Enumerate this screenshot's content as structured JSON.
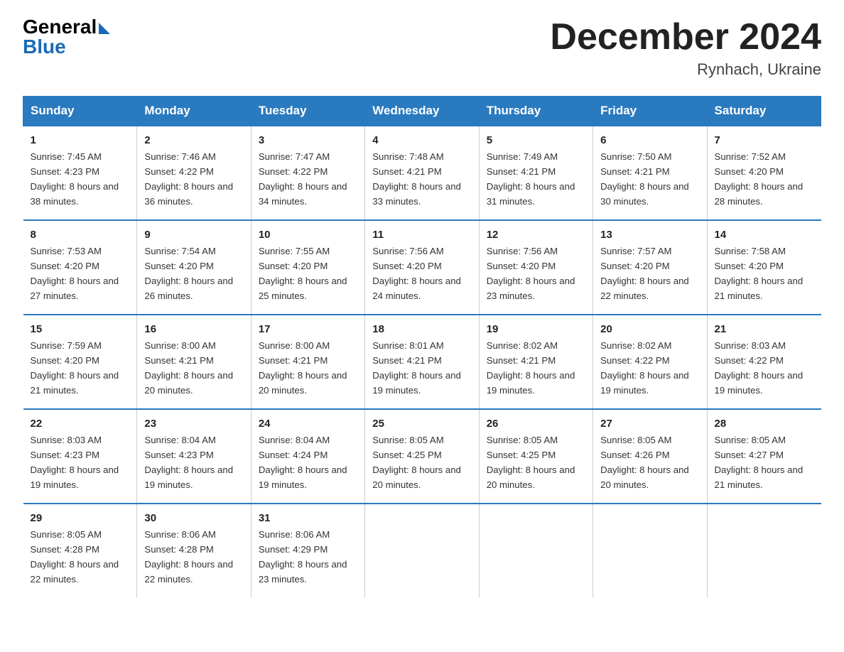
{
  "logo": {
    "general": "General",
    "blue": "Blue"
  },
  "title": "December 2024",
  "location": "Rynhach, Ukraine",
  "days_of_week": [
    "Sunday",
    "Monday",
    "Tuesday",
    "Wednesday",
    "Thursday",
    "Friday",
    "Saturday"
  ],
  "weeks": [
    [
      {
        "day": "1",
        "sunrise": "7:45 AM",
        "sunset": "4:23 PM",
        "daylight": "8 hours and 38 minutes."
      },
      {
        "day": "2",
        "sunrise": "7:46 AM",
        "sunset": "4:22 PM",
        "daylight": "8 hours and 36 minutes."
      },
      {
        "day": "3",
        "sunrise": "7:47 AM",
        "sunset": "4:22 PM",
        "daylight": "8 hours and 34 minutes."
      },
      {
        "day": "4",
        "sunrise": "7:48 AM",
        "sunset": "4:21 PM",
        "daylight": "8 hours and 33 minutes."
      },
      {
        "day": "5",
        "sunrise": "7:49 AM",
        "sunset": "4:21 PM",
        "daylight": "8 hours and 31 minutes."
      },
      {
        "day": "6",
        "sunrise": "7:50 AM",
        "sunset": "4:21 PM",
        "daylight": "8 hours and 30 minutes."
      },
      {
        "day": "7",
        "sunrise": "7:52 AM",
        "sunset": "4:20 PM",
        "daylight": "8 hours and 28 minutes."
      }
    ],
    [
      {
        "day": "8",
        "sunrise": "7:53 AM",
        "sunset": "4:20 PM",
        "daylight": "8 hours and 27 minutes."
      },
      {
        "day": "9",
        "sunrise": "7:54 AM",
        "sunset": "4:20 PM",
        "daylight": "8 hours and 26 minutes."
      },
      {
        "day": "10",
        "sunrise": "7:55 AM",
        "sunset": "4:20 PM",
        "daylight": "8 hours and 25 minutes."
      },
      {
        "day": "11",
        "sunrise": "7:56 AM",
        "sunset": "4:20 PM",
        "daylight": "8 hours and 24 minutes."
      },
      {
        "day": "12",
        "sunrise": "7:56 AM",
        "sunset": "4:20 PM",
        "daylight": "8 hours and 23 minutes."
      },
      {
        "day": "13",
        "sunrise": "7:57 AM",
        "sunset": "4:20 PM",
        "daylight": "8 hours and 22 minutes."
      },
      {
        "day": "14",
        "sunrise": "7:58 AM",
        "sunset": "4:20 PM",
        "daylight": "8 hours and 21 minutes."
      }
    ],
    [
      {
        "day": "15",
        "sunrise": "7:59 AM",
        "sunset": "4:20 PM",
        "daylight": "8 hours and 21 minutes."
      },
      {
        "day": "16",
        "sunrise": "8:00 AM",
        "sunset": "4:21 PM",
        "daylight": "8 hours and 20 minutes."
      },
      {
        "day": "17",
        "sunrise": "8:00 AM",
        "sunset": "4:21 PM",
        "daylight": "8 hours and 20 minutes."
      },
      {
        "day": "18",
        "sunrise": "8:01 AM",
        "sunset": "4:21 PM",
        "daylight": "8 hours and 19 minutes."
      },
      {
        "day": "19",
        "sunrise": "8:02 AM",
        "sunset": "4:21 PM",
        "daylight": "8 hours and 19 minutes."
      },
      {
        "day": "20",
        "sunrise": "8:02 AM",
        "sunset": "4:22 PM",
        "daylight": "8 hours and 19 minutes."
      },
      {
        "day": "21",
        "sunrise": "8:03 AM",
        "sunset": "4:22 PM",
        "daylight": "8 hours and 19 minutes."
      }
    ],
    [
      {
        "day": "22",
        "sunrise": "8:03 AM",
        "sunset": "4:23 PM",
        "daylight": "8 hours and 19 minutes."
      },
      {
        "day": "23",
        "sunrise": "8:04 AM",
        "sunset": "4:23 PM",
        "daylight": "8 hours and 19 minutes."
      },
      {
        "day": "24",
        "sunrise": "8:04 AM",
        "sunset": "4:24 PM",
        "daylight": "8 hours and 19 minutes."
      },
      {
        "day": "25",
        "sunrise": "8:05 AM",
        "sunset": "4:25 PM",
        "daylight": "8 hours and 20 minutes."
      },
      {
        "day": "26",
        "sunrise": "8:05 AM",
        "sunset": "4:25 PM",
        "daylight": "8 hours and 20 minutes."
      },
      {
        "day": "27",
        "sunrise": "8:05 AM",
        "sunset": "4:26 PM",
        "daylight": "8 hours and 20 minutes."
      },
      {
        "day": "28",
        "sunrise": "8:05 AM",
        "sunset": "4:27 PM",
        "daylight": "8 hours and 21 minutes."
      }
    ],
    [
      {
        "day": "29",
        "sunrise": "8:05 AM",
        "sunset": "4:28 PM",
        "daylight": "8 hours and 22 minutes."
      },
      {
        "day": "30",
        "sunrise": "8:06 AM",
        "sunset": "4:28 PM",
        "daylight": "8 hours and 22 minutes."
      },
      {
        "day": "31",
        "sunrise": "8:06 AM",
        "sunset": "4:29 PM",
        "daylight": "8 hours and 23 minutes."
      },
      null,
      null,
      null,
      null
    ]
  ]
}
